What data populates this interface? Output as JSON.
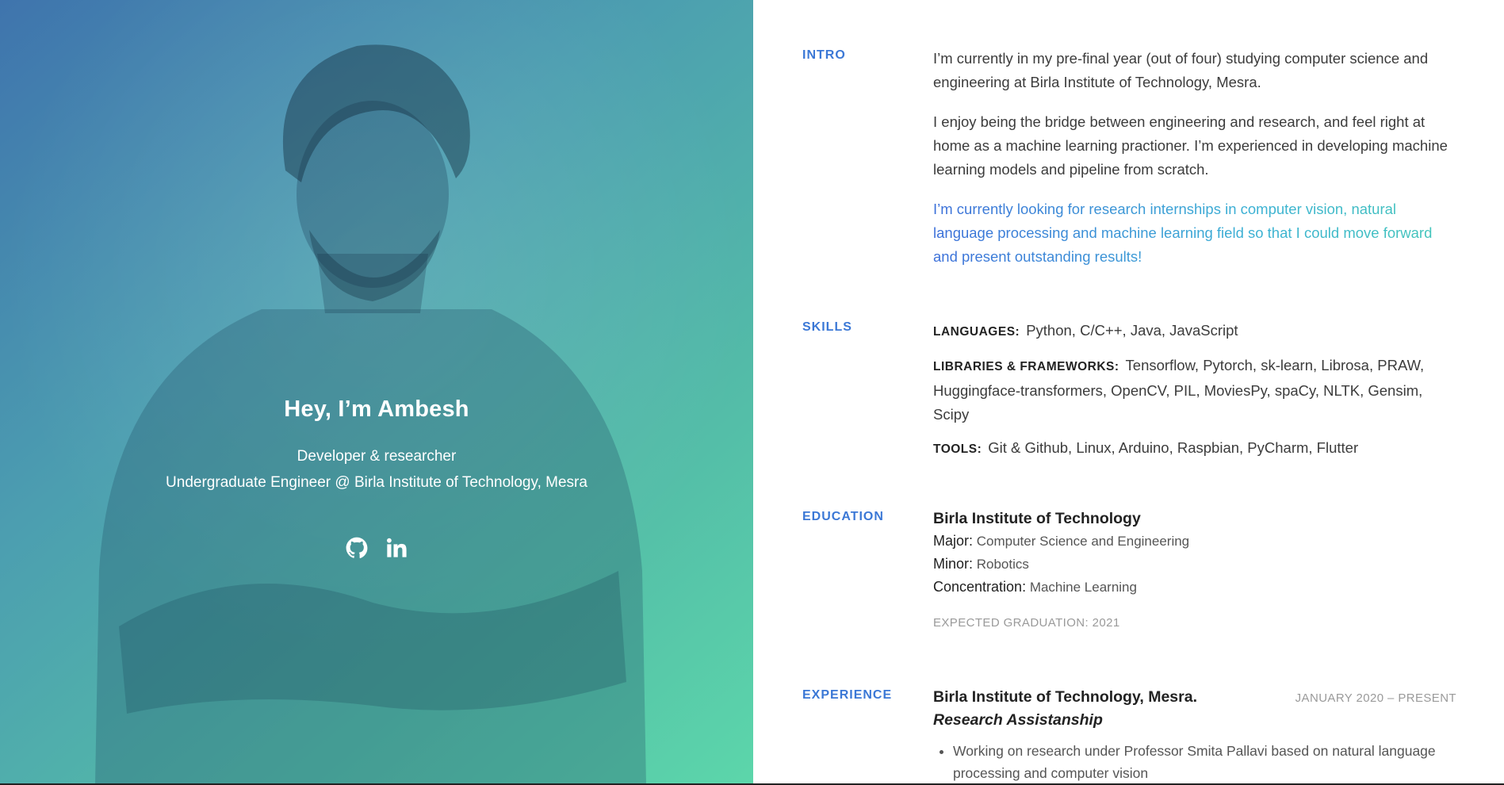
{
  "hero": {
    "title": "Hey, I’m Ambesh",
    "line1": "Developer & researcher",
    "line2": "Undergraduate Engineer @ Birla Institute of Technology, Mesra",
    "icons": [
      "github-icon",
      "linkedin-icon"
    ],
    "gradient_colors": [
      "#3f74ad",
      "#5cd6aa"
    ]
  },
  "intro": {
    "label": "INTRO",
    "p1": "I’m currently in my pre-final year (out of four) studying computer science and engineering at Birla Institute of Technology, Mesra.",
    "p2": "I enjoy being the bridge between engineering and research, and feel right at home as a machine learning practioner. I’m experienced in developing machine learning models and pipeline from scratch.",
    "p3": "I’m currently looking for research internships in computer vision, natural language processing and machine learning field so that I could move forward and present outstanding results!"
  },
  "skills": {
    "label": "SKILLS",
    "languages_key": "LANGUAGES:",
    "languages": "Python, C/C++, Java, JavaScript",
    "libraries_key": "LIBRARIES & FRAMEWORKS:",
    "libraries": "Tensorflow, Pytorch, sk-learn, Librosa, PRAW, Huggingface-transformers, OpenCV, PIL, MoviesPy, spaCy, NLTK, Gensim, Scipy",
    "tools_key": "TOOLS:",
    "tools": "Git & Github, Linux, Arduino, Raspbian, PyCharm, Flutter"
  },
  "education": {
    "label": "EDUCATION",
    "school": "Birla Institute of Technology",
    "major_key": "Major:",
    "major": "Computer Science and Engineering",
    "minor_key": "Minor:",
    "minor": "Robotics",
    "concentration_key": "Concentration:",
    "concentration": "Machine Learning",
    "graduation": "EXPECTED GRADUATION: 2021"
  },
  "experience": {
    "label": "EXPERIENCE",
    "org": "Birla Institute of Technology, Mesra.",
    "date": "JANUARY 2020 – PRESENT",
    "role": "Research Assistanship",
    "bullet1": "Working on research under Professor Smita Pallavi based on natural language processing and computer vision"
  },
  "colors": {
    "accent": "#3b78d6",
    "accent_gradient": [
      "#3b6fd9",
      "#43c7b8"
    ]
  }
}
